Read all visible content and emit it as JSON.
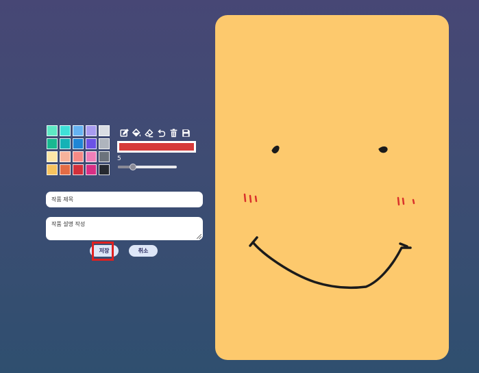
{
  "palette": {
    "colors": [
      "#5ee8c4",
      "#3fe0d8",
      "#66b3f2",
      "#a89cf0",
      "#dadde3",
      "#19b891",
      "#14b2b6",
      "#1f86d6",
      "#6b52e6",
      "#aeb4bd",
      "#fde6a7",
      "#f6b29b",
      "#f58a86",
      "#ef7fb9",
      "#6c737c",
      "#f7c35e",
      "#e36c45",
      "#d3303b",
      "#d82f85",
      "#252930"
    ]
  },
  "tools": {
    "icons": [
      "pencil-icon",
      "fill-bucket-icon",
      "eraser-icon",
      "undo-icon",
      "trash-icon",
      "save-icon"
    ]
  },
  "current_color": "#d63a3a",
  "brush": {
    "size_label": "5",
    "size_value": 5,
    "size_max": 20
  },
  "form": {
    "title_placeholder": "작품 제목",
    "description_placeholder": "작품 설명 작성",
    "save_label": "저장",
    "cancel_label": "취소"
  },
  "canvas": {
    "background": "#fdc96d",
    "stroke_colors": {
      "eyes_mouth": "#1b1b1b",
      "blush": "#d9312b"
    }
  }
}
